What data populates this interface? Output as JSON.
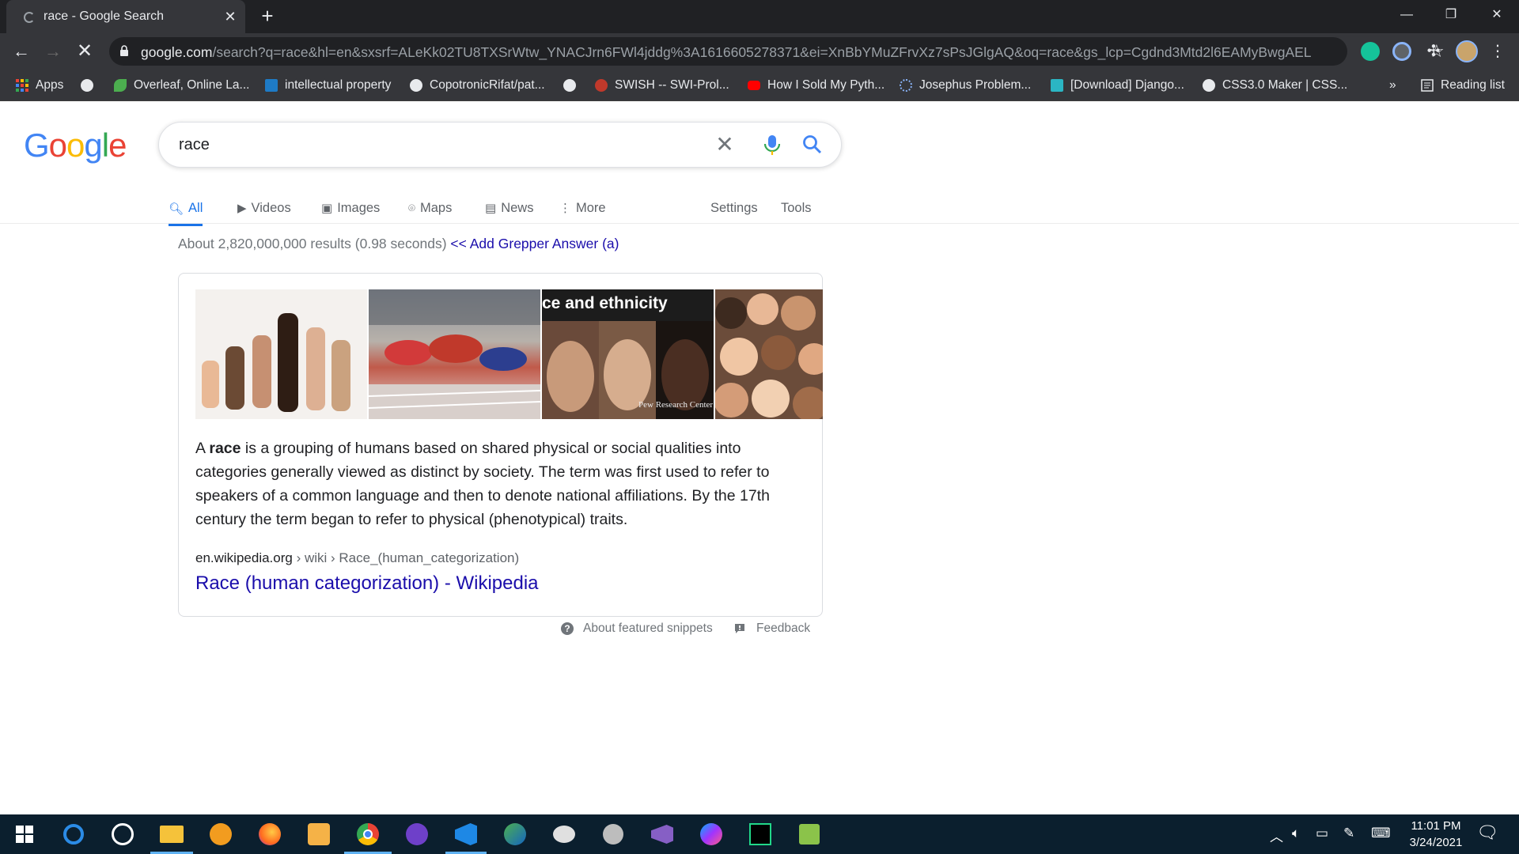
{
  "browser": {
    "tab_title": "race - Google Search",
    "url_host": "google.com",
    "url_path": "/search?q=race&hl=en&sxsrf=ALeKk02TU8TXSrWtw_YNACJrn6FWl4jddg%3A1616605278371&ei=XnBbYMuZFrvXz7sPsJGlgAQ&oq=race&gs_lcp=Cgdnd3Mtd2l6EAMyBwgAELE...",
    "bookmarks": [
      {
        "label": "Apps",
        "icon": "apps-grid-icon"
      },
      {
        "label": "",
        "icon": "globe-icon"
      },
      {
        "label": "Overleaf, Online La...",
        "icon": "overleaf-icon"
      },
      {
        "label": "intellectual property",
        "icon": "scribd-icon"
      },
      {
        "label": "CopotronicRifat/pat...",
        "icon": "github-icon"
      },
      {
        "label": "",
        "icon": "globe-icon"
      },
      {
        "label": "SWISH -- SWI-Prol...",
        "icon": "swish-icon"
      },
      {
        "label": "How I Sold My Pyth...",
        "icon": "youtube-icon"
      },
      {
        "label": "Josephus Problem...",
        "icon": "loading-icon"
      },
      {
        "label": "[Download] Django...",
        "icon": "site-icon"
      },
      {
        "label": "CSS3.0 Maker | CSS...",
        "icon": "globe-icon"
      }
    ],
    "bookmarks_overflow": "»",
    "reading_list": "Reading list"
  },
  "google": {
    "logo": "Google",
    "query": "race",
    "tabs": [
      "All",
      "Videos",
      "Images",
      "Maps",
      "News",
      "More"
    ],
    "settings": "Settings",
    "tools": "Tools",
    "result_stats": "About 2,820,000,000 results (0.98 seconds)",
    "grepper_link": "<< Add Grepper Answer (a)",
    "snippet": {
      "image_text": "ce and ethnicity",
      "image_credit": "Pew Research Center",
      "text_before": "A ",
      "text_bold": "race",
      "text_after": " is a grouping of humans based on shared physical or social qualities into categories generally viewed as distinct by society. The term was first used to refer to speakers of a common language and then to denote national affiliations. By the 17th century the term began to refer to physical (phenotypical) traits.",
      "cite_host": "en.wikipedia.org",
      "cite_path": " › wiki › Race_(human_categorization)",
      "link_title": "Race (human categorization) - Wikipedia",
      "about": "About featured snippets",
      "feedback": "Feedback"
    }
  },
  "taskbar": {
    "time": "11:01 PM",
    "date": "3/24/2021"
  },
  "colors": {
    "google_blue": "#4285f4",
    "google_red": "#ea4335",
    "google_yellow": "#fbbc05",
    "google_green": "#34a853",
    "link": "#1a0dab"
  }
}
